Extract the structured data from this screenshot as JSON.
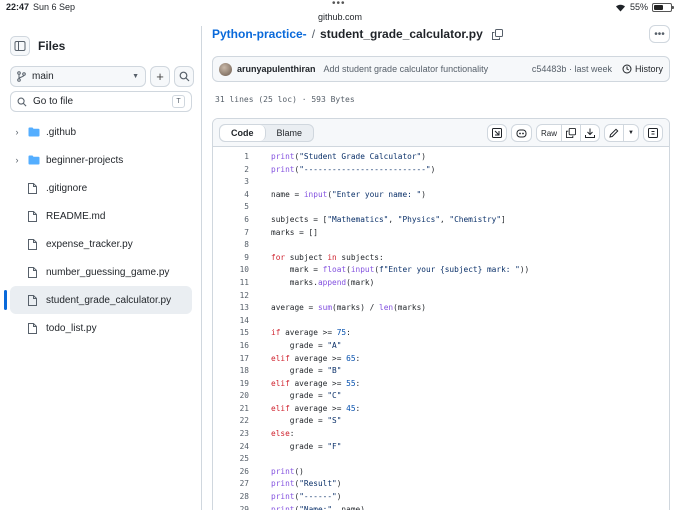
{
  "status_bar": {
    "time": "22:47",
    "date": "Sun 6 Sep",
    "url": "github.com",
    "battery": "55%",
    "battery_level": 0.55
  },
  "sidebar": {
    "title": "Files",
    "branch": "main",
    "goto_placeholder": "Go to file",
    "goto_shortcut": "T",
    "items": [
      {
        "name": ".github",
        "type": "folder"
      },
      {
        "name": "beginner-projects",
        "type": "folder"
      },
      {
        "name": ".gitignore",
        "type": "file"
      },
      {
        "name": "README.md",
        "type": "file"
      },
      {
        "name": "expense_tracker.py",
        "type": "file"
      },
      {
        "name": "number_guessing_game.py",
        "type": "file"
      },
      {
        "name": "student_grade_calculator.py",
        "type": "file",
        "active": true
      },
      {
        "name": "todo_list.py",
        "type": "file"
      }
    ]
  },
  "breadcrumb": {
    "repo": "Python-practice-",
    "separator": "/",
    "file": "student_grade_calculator.py"
  },
  "commit": {
    "author": "arunyapulenthiran",
    "message": "Add student grade calculator functionality",
    "hash": "c54483b",
    "time": "· last week",
    "history_label": "History"
  },
  "file_info": "31 lines (25 loc) · 593 Bytes",
  "code_view": {
    "tab_code": "Code",
    "tab_blame": "Blame",
    "raw_label": "Raw"
  },
  "code_lines": [
    "print(\"Student Grade Calculator\")",
    "print(\"--------------------------\")",
    "",
    "name = input(\"Enter your name: \")",
    "",
    "subjects = [\"Mathematics\", \"Physics\", \"Chemistry\"]",
    "marks = []",
    "",
    "for subject in subjects:",
    "    mark = float(input(f\"Enter your {subject} mark: \"))",
    "    marks.append(mark)",
    "",
    "average = sum(marks) / len(marks)",
    "",
    "if average >= 75:",
    "    grade = \"A\"",
    "elif average >= 65:",
    "    grade = \"B\"",
    "elif average >= 55:",
    "    grade = \"C\"",
    "elif average >= 45:",
    "    grade = \"S\"",
    "else:",
    "    grade = \"F\"",
    "",
    "print()",
    "print(\"Result\")",
    "print(\"------\")",
    "print(\"Name:\", name)"
  ]
}
